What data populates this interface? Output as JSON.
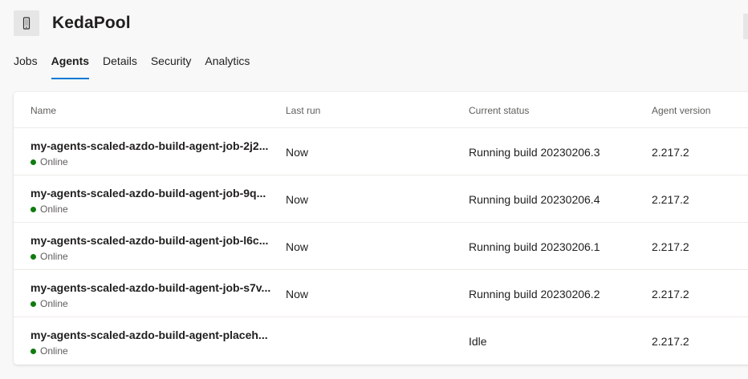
{
  "pool": {
    "title": "KedaPool",
    "icon": "phone-icon"
  },
  "tabs": [
    {
      "label": "Jobs",
      "active": false
    },
    {
      "label": "Agents",
      "active": true
    },
    {
      "label": "Details",
      "active": false
    },
    {
      "label": "Security",
      "active": false
    },
    {
      "label": "Analytics",
      "active": false
    }
  ],
  "colors": {
    "accent": "#0078d4",
    "online": "#107c10"
  },
  "table": {
    "columns": {
      "name": "Name",
      "last_run": "Last run",
      "current_status": "Current status",
      "agent_version": "Agent version"
    },
    "rows": [
      {
        "name": "my-agents-scaled-azdo-build-agent-job-2j2...",
        "status": "Online",
        "last_run": "Now",
        "current_status": "Running build 20230206.3",
        "version": "2.217.2"
      },
      {
        "name": "my-agents-scaled-azdo-build-agent-job-9q...",
        "status": "Online",
        "last_run": "Now",
        "current_status": "Running build 20230206.4",
        "version": "2.217.2"
      },
      {
        "name": "my-agents-scaled-azdo-build-agent-job-l6c...",
        "status": "Online",
        "last_run": "Now",
        "current_status": "Running build 20230206.1",
        "version": "2.217.2"
      },
      {
        "name": "my-agents-scaled-azdo-build-agent-job-s7v...",
        "status": "Online",
        "last_run": "Now",
        "current_status": "Running build 20230206.2",
        "version": "2.217.2"
      },
      {
        "name": "my-agents-scaled-azdo-build-agent-placeh...",
        "status": "Online",
        "last_run": "",
        "current_status": "Idle",
        "version": "2.217.2"
      }
    ]
  }
}
